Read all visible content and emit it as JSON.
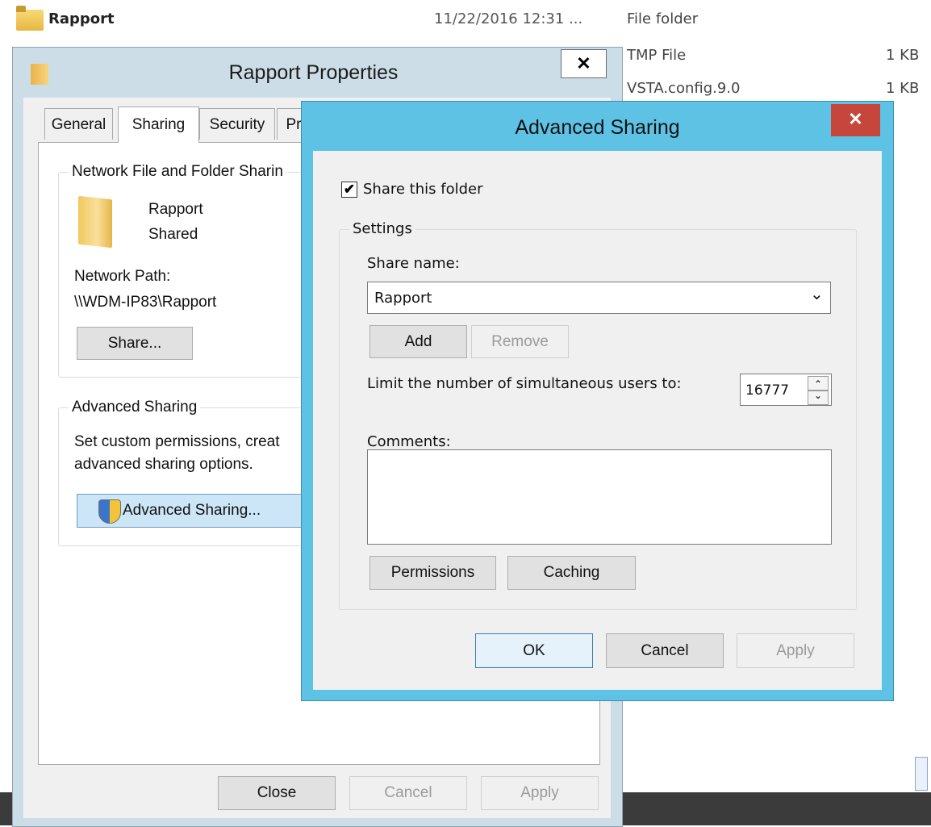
{
  "explorer": {
    "rows": [
      {
        "name": "Rapport",
        "date": "11/22/2016 12:31 ...",
        "type": "File folder",
        "size": ""
      },
      {
        "name": "",
        "date": "",
        "type": "TMP File",
        "size": "1 KB"
      },
      {
        "name": "",
        "date": "",
        "type": "VSTA.config.9.0",
        "size": "1 KB"
      }
    ]
  },
  "properties": {
    "title": "Rapport Properties",
    "close_glyph": "✕",
    "tabs": [
      "General",
      "Sharing",
      "Security",
      "Pr"
    ],
    "network_group_label": "Network File and Folder Sharin",
    "folder_name": "Rapport",
    "folder_state": "Shared",
    "network_path_label": "Network Path:",
    "network_path": "\\\\WDM-IP83\\Rapport",
    "share_button": "Share...",
    "advanced_group_label": "Advanced Sharing",
    "advanced_desc_line1": "Set custom permissions, creat",
    "advanced_desc_line2": "advanced sharing options.",
    "advanced_button": "Advanced Sharing...",
    "close_button": "Close",
    "cancel_button": "Cancel",
    "apply_button": "Apply"
  },
  "advanced_sharing": {
    "title": "Advanced Sharing",
    "close_glyph": "✕",
    "share_checkbox_label": "Share this folder",
    "share_checked": true,
    "settings_label": "Settings",
    "share_name_label": "Share name:",
    "share_name_value": "Rapport",
    "add_button": "Add",
    "remove_button": "Remove",
    "limit_label": "Limit the number of simultaneous users to:",
    "limit_value": "16777",
    "comments_label": "Comments:",
    "comments_value": "",
    "permissions_button": "Permissions",
    "caching_button": "Caching",
    "ok_button": "OK",
    "cancel_button": "Cancel",
    "apply_button": "Apply"
  },
  "icons": {
    "check": "✔",
    "dropdown": "⌄",
    "spin_up": "⌃",
    "spin_down": "⌄"
  },
  "colors": {
    "dialog_frame": "#5ec2e5",
    "close_red": "#c7463b",
    "props_frame": "#ccdde7"
  }
}
